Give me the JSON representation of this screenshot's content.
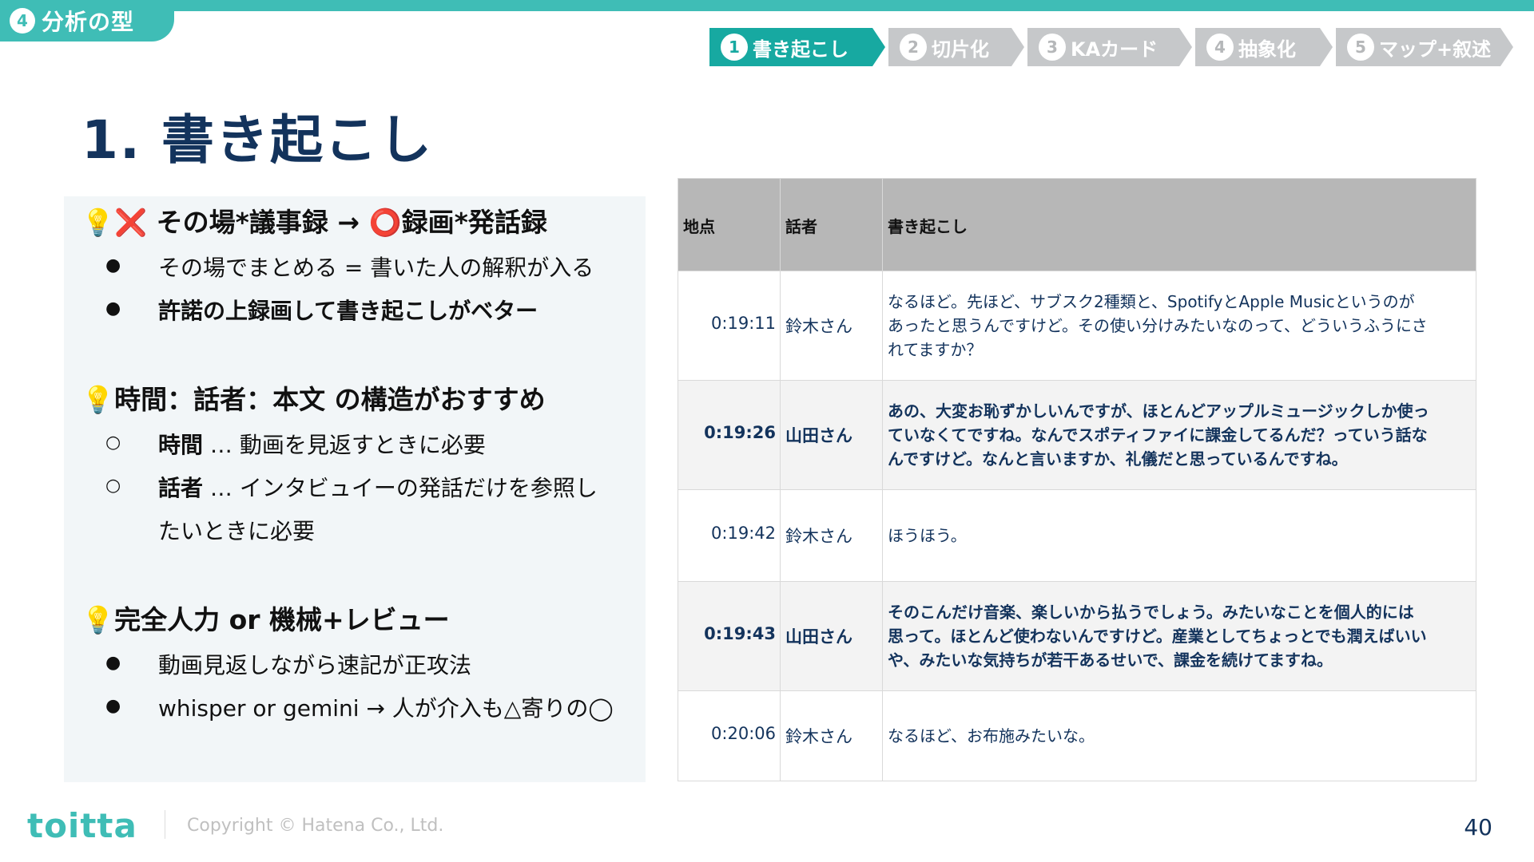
{
  "section": {
    "number": "4",
    "label": "分析の型"
  },
  "steps": [
    {
      "num": "1",
      "label": "書き起こし"
    },
    {
      "num": "2",
      "label": "切片化"
    },
    {
      "num": "3",
      "label": "KAカード"
    },
    {
      "num": "4",
      "label": "抽象化"
    },
    {
      "num": "5",
      "label": "マップ+叙述"
    }
  ],
  "title": "1. 書き起こし",
  "panel": {
    "h1": "💡❌ その場*議事録 → ⭕録画*発話録",
    "h1_b1": "その場でまとめる = 書いた人の解釈が入る",
    "h1_b2": "許諾の上録画して書き起こしがベター",
    "h2": "💡時間：話者：本文 の構造がおすすめ",
    "h2_b1_strong": "時間",
    "h2_b1_rest": " … 動画を見返すときに必要",
    "h2_b2_strong": "話者",
    "h2_b2_rest": " … インタビュイーの発話だけを参照し",
    "h2_b2_cont": "たいときに必要",
    "h3": "💡完全人力 or 機械+レビュー",
    "h3_b1": "動画見返しながら速記が正攻法",
    "h3_b2": "whisper or gemini → 人が介入も△寄りの◯",
    "bullet_dot": "●",
    "bullet_circle": "○"
  },
  "table": {
    "headers": [
      "地点",
      "話者",
      "書き起こし"
    ],
    "rows": [
      {
        "time": "0:19:11",
        "speaker": "鈴木さん",
        "lines": [
          "なるほど。先ほど、サブスク2種類と、SpotifyとApple Musicというのが",
          "あったと思うんですけど。その使い分けみたいなのって、どういうふうにさ",
          "れてますか？"
        ]
      },
      {
        "time": "0:19:26",
        "speaker": "山田さん",
        "lines": [
          "あの、大変お恥ずかしいんですが、ほとんどアップルミュージックしか使っ",
          "ていなくてですね。なんでスポティファイに課金してるんだ？っていう話な",
          "んですけど。なんと言いますか、礼儀だと思っているんですね。"
        ]
      },
      {
        "time": "0:19:42",
        "speaker": "鈴木さん",
        "lines": [
          "ほうほう。"
        ]
      },
      {
        "time": "0:19:43",
        "speaker": "山田さん",
        "lines": [
          "そのこんだけ音楽、楽しいから払うでしょう。みたいなことを個人的には",
          "思って。ほとんど使わないんですけど。産業としてちょっとでも潤えばいい",
          "や、みたいな気持ちが若干あるせいで、課金を続けてますね。"
        ]
      },
      {
        "time": "0:20:06",
        "speaker": "鈴木さん",
        "lines": [
          "なるほど、お布施みたいな。"
        ]
      }
    ]
  },
  "footer": {
    "logo": "toitta",
    "copyright": "Copyright © Hatena Co., Ltd.",
    "page": "40"
  },
  "colors": {
    "accent": "#3fbdb6",
    "active_step": "#17a9a1",
    "inactive_step": "#c6c8ca",
    "navy": "#13335c"
  }
}
